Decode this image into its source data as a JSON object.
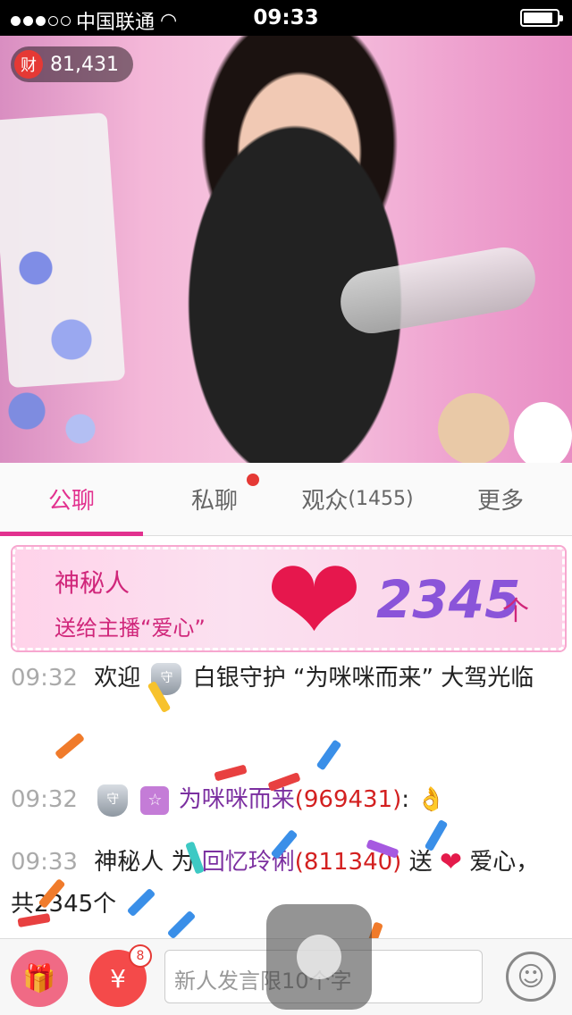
{
  "status_bar": {
    "carrier": "中国联通",
    "time": "09:33"
  },
  "stream": {
    "wealth_icon_label": "财",
    "wealth_value": "81,431"
  },
  "tabs": [
    {
      "label": "公聊",
      "count": ""
    },
    {
      "label": "私聊",
      "count": ""
    },
    {
      "label": "观众",
      "count": "(1455)"
    },
    {
      "label": "更多",
      "count": ""
    }
  ],
  "gift_banner": {
    "sender": "神秘人",
    "line": "送给主播“爱心”",
    "count": "2345",
    "unit": "个"
  },
  "messages": [
    {
      "time": "09:32",
      "prefix": "欢迎",
      "badge_label": "守",
      "text": "白银守护 “为咪咪而来” 大驾光临"
    },
    {
      "time": "09:32",
      "badge_label": "守",
      "user": "为咪咪而来",
      "user_id": "(969431)",
      "suffix": ":"
    },
    {
      "time": "09:33",
      "sender": "神秘人",
      "verb": "为",
      "target": "回忆玲俐",
      "target_id": "(811340)",
      "action": "送",
      "gift": "爱心",
      "total": "，共2345个"
    }
  ],
  "bottom_bar": {
    "redpack_icon_label": "¥",
    "redpack_badge": "8",
    "input_placeholder": "新人发言限10个字"
  },
  "colors": {
    "accent": "#e2318f",
    "user_name": "#7b2fa0",
    "user_id": "#d32020"
  }
}
